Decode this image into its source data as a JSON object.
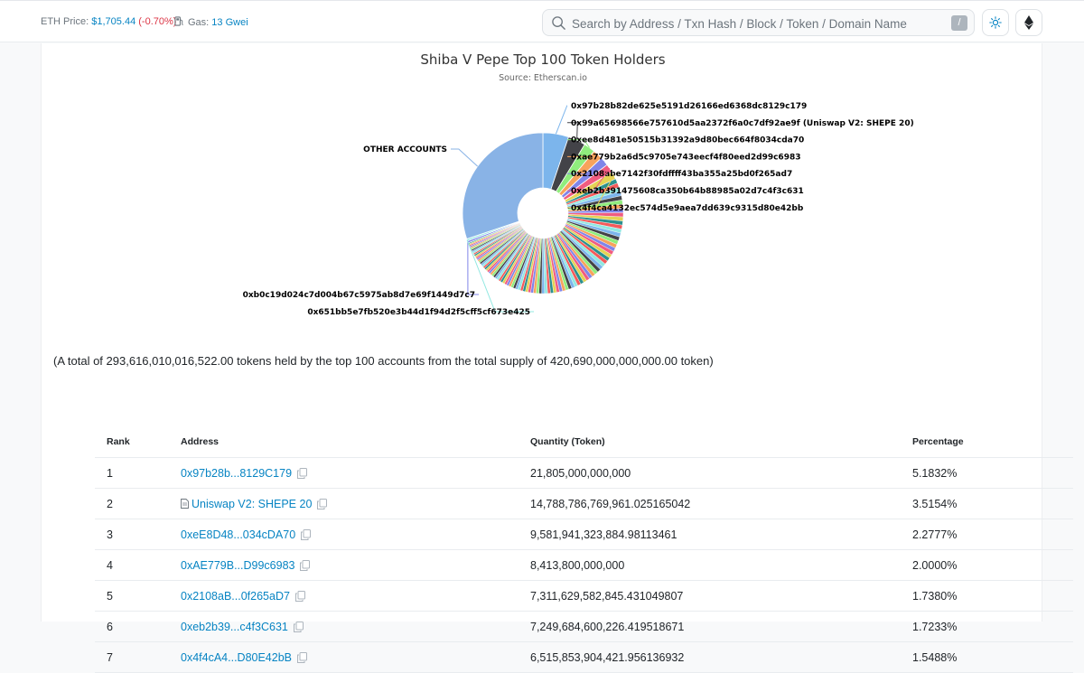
{
  "header": {
    "eth_price_label": "ETH Price:",
    "eth_price_value": "$1,705.44",
    "eth_price_change": "(-0.70%)",
    "gas_label": "Gas:",
    "gas_value": "13 Gwei",
    "search_placeholder": "Search by Address / Txn Hash / Block / Token / Domain Name",
    "search_shortcut": "/",
    "theme_icon": "sun-icon",
    "network_icon": "ethereum-icon"
  },
  "chart_data": {
    "type": "pie",
    "title": "Shiba V Pepe Top 100 Token Holders",
    "subtitle": "Source: Etherscan.io",
    "total_accounts": 100,
    "slices": [
      {
        "label": "OTHER ACCOUNTS",
        "percent": 30.2,
        "color": "#89b3e6"
      },
      {
        "label": "0x97b28b82de625e5191d26166ed6368dc8129c179",
        "percent": 5.1832,
        "color": "#7cb5ec"
      },
      {
        "label": "0x99a65698566e757610d5aa2372f6a0c7df92ae9f (Uniswap V2: SHEPE 20)",
        "percent": 3.5154,
        "color": "#434348"
      },
      {
        "label": "0xee8d481e50515b31392a9d80bec664f8034cda70",
        "percent": 2.2777,
        "color": "#90ed7d"
      },
      {
        "label": "0xae779b2a6d5c9705e743eecf4f80eed2d99c6983",
        "percent": 2.0,
        "color": "#f7a35c"
      },
      {
        "label": "0x2108abe7142f30fdffff43ba355a25bd0f265ad7",
        "percent": 1.738,
        "color": "#8085e9"
      },
      {
        "label": "0xeb2b391475608ca350b64b88985a02d7c4f3c631",
        "percent": 1.7233,
        "color": "#f15c80"
      },
      {
        "label": "0x4f4ca4132ec574d5e9aea7dd639c9315d80e42bb",
        "percent": 1.5488,
        "color": "#e4d354"
      },
      {
        "label": "0xb0c19d024c7d004b67c5975ab8d7e69f1449d7c7",
        "percent": 0.42,
        "color": "#8085e8"
      },
      {
        "label": "0x651bb5e7fb520e3b44d1f94d2f5cff5cf673e425",
        "percent": 0.4,
        "color": "#91e8e1"
      }
    ],
    "palette": [
      "#7cb5ec",
      "#434348",
      "#90ed7d",
      "#f7a35c",
      "#8085e9",
      "#f15c80",
      "#e4d354",
      "#2b908f",
      "#f45b5b",
      "#91e8e1"
    ]
  },
  "summary_text": "(A total of 293,616,010,016,522.00 tokens held by the top 100 accounts from the total supply of 420,690,000,000,000.00 token)",
  "table": {
    "columns": [
      "Rank",
      "Address",
      "Quantity (Token)",
      "Percentage"
    ],
    "rows": [
      {
        "rank": "1",
        "address": "0x97b28b...8129C179",
        "is_contract": false,
        "quantity": "21,805,000,000,000",
        "percentage": "5.1832%"
      },
      {
        "rank": "2",
        "address": "Uniswap V2: SHEPE 20",
        "is_contract": true,
        "quantity": "14,788,786,769,961.025165042",
        "percentage": "3.5154%"
      },
      {
        "rank": "3",
        "address": "0xeE8D48...034cDA70",
        "is_contract": false,
        "quantity": "9,581,941,323,884.98113461",
        "percentage": "2.2777%"
      },
      {
        "rank": "4",
        "address": "0xAE779B...D99c6983",
        "is_contract": false,
        "quantity": "8,413,800,000,000",
        "percentage": "2.0000%"
      },
      {
        "rank": "5",
        "address": "0x2108aB...0f265aD7",
        "is_contract": false,
        "quantity": "7,311,629,582,845.431049807",
        "percentage": "1.7380%"
      },
      {
        "rank": "6",
        "address": "0xeb2b39...c4f3C631",
        "is_contract": false,
        "quantity": "7,249,684,600,226.419518671",
        "percentage": "1.7233%"
      },
      {
        "rank": "7",
        "address": "0x4f4cA4...D80E42bB",
        "is_contract": false,
        "quantity": "6,515,853,904,421.956136932",
        "percentage": "1.5488%"
      }
    ]
  }
}
